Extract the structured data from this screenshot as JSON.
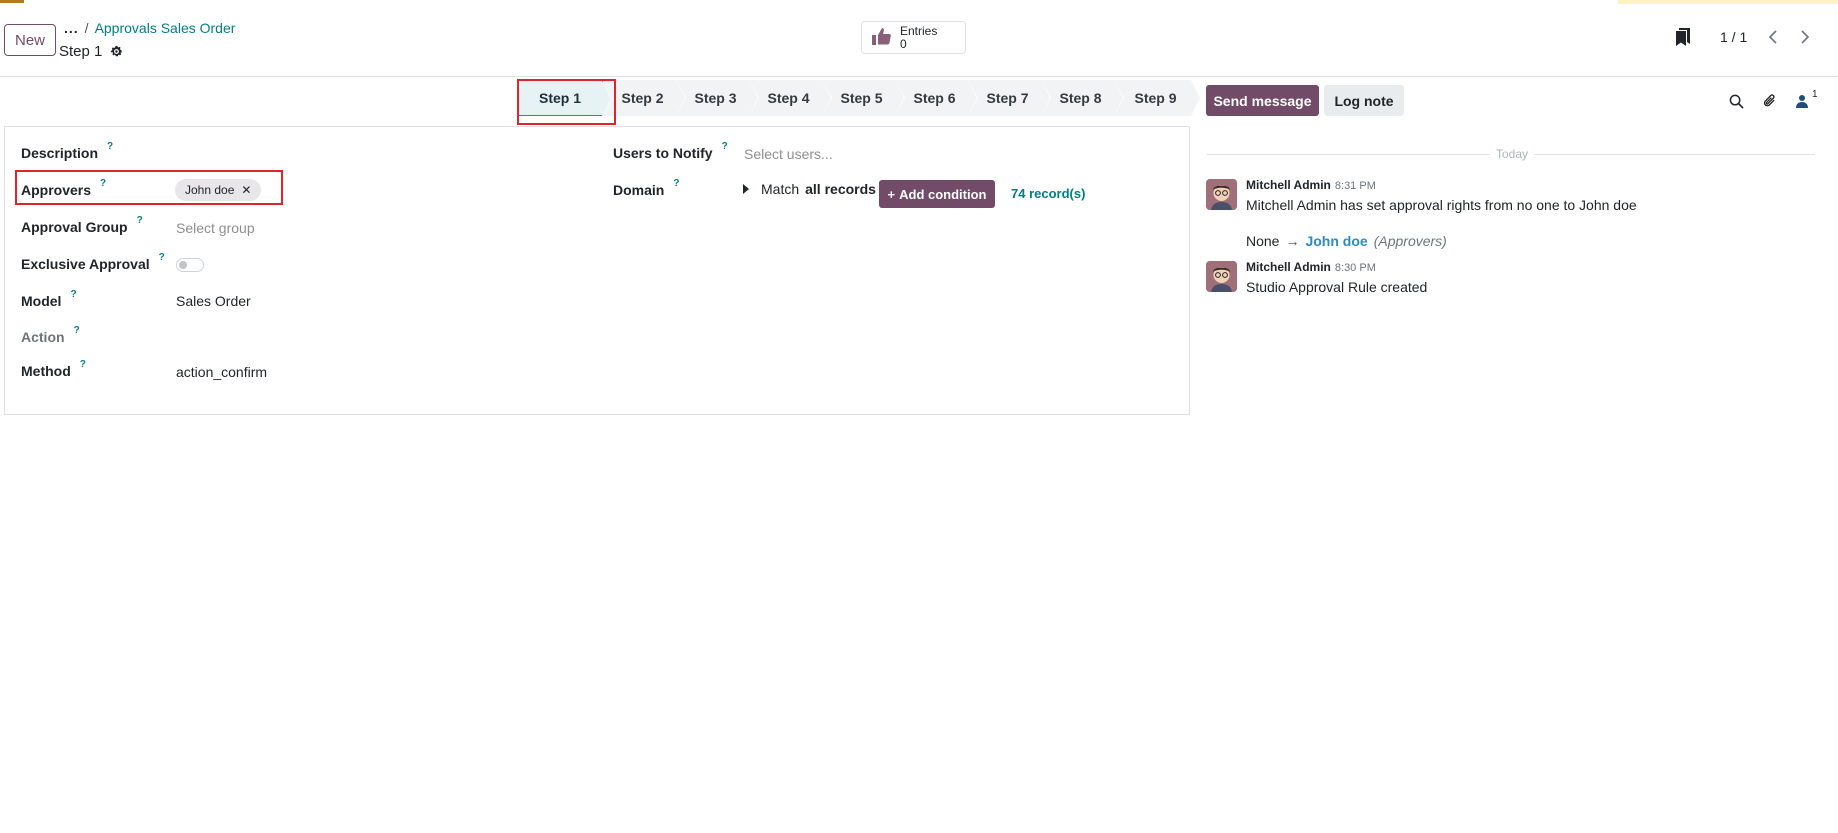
{
  "header": {
    "new_button": "New",
    "breadcrumb_dots": "...",
    "breadcrumb_sep": "/",
    "breadcrumb_parent": "Approvals Sales Order",
    "record_title": "Step 1"
  },
  "entries": {
    "label": "Entries",
    "count": "0"
  },
  "pager": {
    "value": "1 / 1"
  },
  "statusbar": {
    "steps": [
      "Step 1",
      "Step 2",
      "Step 3",
      "Step 4",
      "Step 5",
      "Step 6",
      "Step 7",
      "Step 8",
      "Step 9"
    ],
    "active_index": 0
  },
  "form": {
    "left": {
      "description_label": "Description",
      "approvers_label": "Approvers",
      "approvers_tag": "John doe",
      "approval_group_label": "Approval Group",
      "approval_group_placeholder": "Select group",
      "exclusive_label": "Exclusive Approval",
      "exclusive_value": false,
      "model_label": "Model",
      "model_value": "Sales Order",
      "action_label": "Action",
      "method_label": "Method",
      "method_value": "action_confirm"
    },
    "right": {
      "users_label": "Users to Notify",
      "users_placeholder": "Select users...",
      "domain_label": "Domain",
      "domain_match": "Match",
      "domain_all": "all records",
      "add_condition": "Add condition",
      "records_count": "74 record(s)"
    },
    "help_mark": "?"
  },
  "chatter": {
    "send_message": "Send message",
    "log_note": "Log note",
    "followers_count": "1",
    "date_separator": "Today",
    "messages": [
      {
        "author": "Mitchell Admin",
        "time": "8:31 PM",
        "body": "Mitchell Admin has set approval rights from no one to John doe",
        "tracking": {
          "old": "None",
          "arrow": "→",
          "new": "John doe",
          "field": "(Approvers)"
        }
      },
      {
        "author": "Mitchell Admin",
        "time": "8:30 PM",
        "body": "Studio Approval Rule created"
      }
    ]
  },
  "colors": {
    "primary": "#714b67",
    "link": "#017e84",
    "highlight": "#e0242b"
  }
}
